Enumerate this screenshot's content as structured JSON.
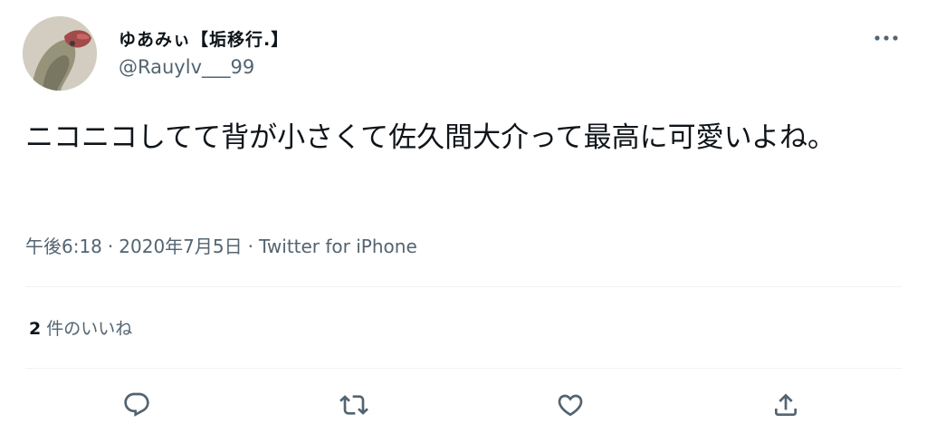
{
  "user": {
    "display_name": "ゆあみぃ【垢移行.】",
    "handle": "@Rauylv___99",
    "avatar_icon": "avatar-photo"
  },
  "tweet": {
    "text": "ニコニコしてて背が小さくて佐久間大介って最高に可愛いよね。"
  },
  "meta": {
    "time": "午後6:18",
    "separator": "·",
    "date": "2020年7月5日",
    "source": "Twitter for iPhone"
  },
  "stats": {
    "likes_count": "2",
    "likes_label": "件のいいね"
  },
  "actions": {
    "reply_icon": "reply-icon",
    "retweet_icon": "retweet-icon",
    "like_icon": "heart-icon",
    "share_icon": "share-icon",
    "more_icon": "more-icon"
  },
  "colors": {
    "text_primary": "#0f1419",
    "text_secondary": "#536471",
    "divider": "#eff3f4"
  }
}
